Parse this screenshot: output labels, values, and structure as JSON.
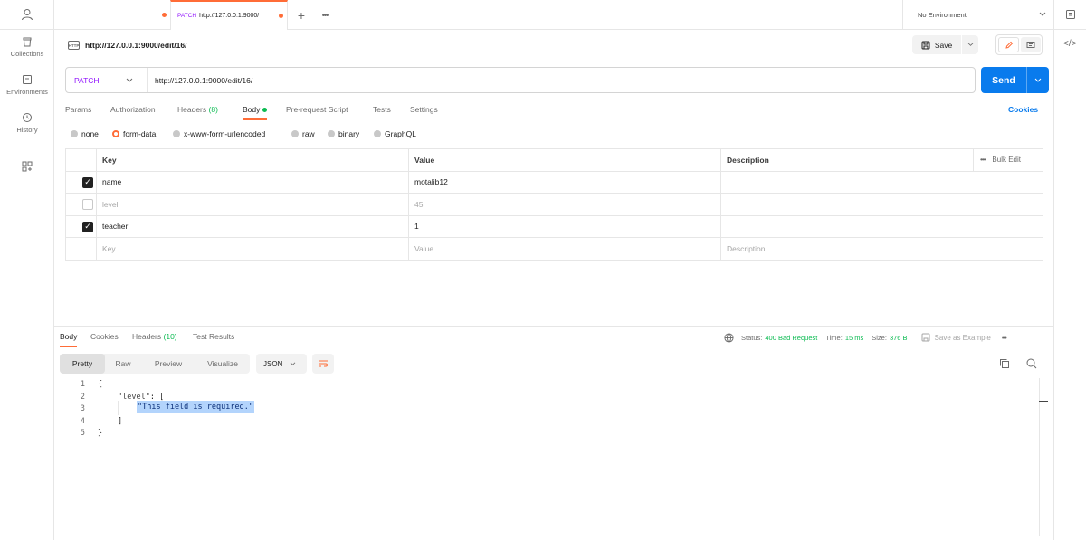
{
  "sidebar": {
    "items": [
      {
        "label": "Collections",
        "icon": "trash-can-icon"
      },
      {
        "label": "Environments",
        "icon": "environment-icon"
      },
      {
        "label": "History",
        "icon": "history-icon"
      }
    ]
  },
  "tabs": {
    "active": {
      "method": "PATCH",
      "title": "http://127.0.0.1:9000/"
    }
  },
  "environment": {
    "label": "No Environment"
  },
  "request": {
    "title": "http://127.0.0.1:9000/edit/16/",
    "http_badge": "HTTP",
    "save_label": "Save",
    "method": "PATCH",
    "url": "http://127.0.0.1:9000/edit/16/",
    "send_label": "Send",
    "cookies_label": "Cookies",
    "tabs": {
      "params": "Params",
      "authorization": "Authorization",
      "headers": "Headers",
      "headers_count": "(8)",
      "body": "Body",
      "pre_request": "Pre-request Script",
      "tests": "Tests",
      "settings": "Settings"
    },
    "body_types": {
      "none": "none",
      "form_data": "form-data",
      "urlencoded": "x-www-form-urlencoded",
      "raw": "raw",
      "binary": "binary",
      "graphql": "GraphQL"
    },
    "table": {
      "headers": {
        "key": "Key",
        "value": "Value",
        "description": "Description",
        "bulk_edit": "Bulk Edit"
      },
      "rows": [
        {
          "key": "name",
          "value": "motalib12",
          "checked": true
        },
        {
          "key": "level",
          "value": "45",
          "checked": false
        },
        {
          "key": "teacher",
          "value": "1",
          "checked": true
        }
      ],
      "placeholder": {
        "key": "Key",
        "value": "Value",
        "description": "Description"
      }
    }
  },
  "response": {
    "tabs": {
      "body": "Body",
      "cookies": "Cookies",
      "headers": "Headers",
      "headers_count": "(10)",
      "test_results": "Test Results"
    },
    "status_label": "Status:",
    "status_value": "400 Bad Request",
    "time_label": "Time:",
    "time_value": "15 ms",
    "size_label": "Size:",
    "size_value": "376 B",
    "save_example": "Save as Example",
    "view_modes": {
      "pretty": "Pretty",
      "raw": "Raw",
      "preview": "Preview",
      "visualize": "Visualize"
    },
    "format": "JSON",
    "code_lines": {
      "l1": "{",
      "l2_key": "\"level\"",
      "l2_rest": ": [",
      "l3": "\"This field is required.\"",
      "l4": "]",
      "l5": "}"
    },
    "line_numbers": [
      "1",
      "2",
      "3",
      "4",
      "5"
    ]
  },
  "colors": {
    "accent": "#ff6c37",
    "send": "#097bed",
    "method": "#9012fe",
    "success": "#0cbb52"
  }
}
